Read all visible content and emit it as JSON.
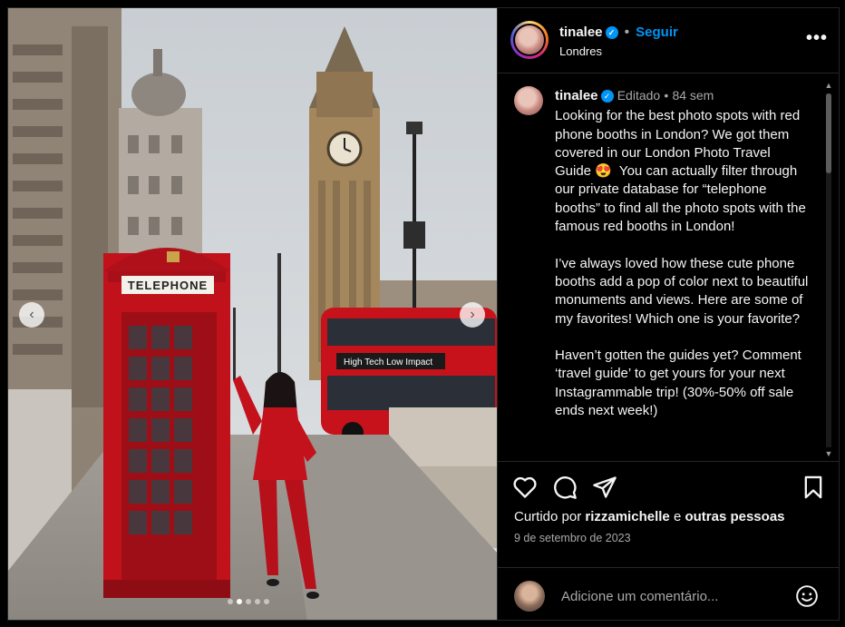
{
  "photo": {
    "booth_sign": "TELEPHONE",
    "bus_banner": "High Tech Low Impact"
  },
  "carousel": {
    "current": 2,
    "total": 5
  },
  "header": {
    "username": "tinalee",
    "separator": "•",
    "follow_label": "Seguir",
    "location": "Londres",
    "more_label": "•••"
  },
  "caption": {
    "username": "tinalee",
    "edited_label": "Editado",
    "separator": "•",
    "age": "84 sem",
    "text": "Looking for the best photo spots with red phone booths in London? We got them covered in our London Photo Travel Guide 😍  You can actually filter through our private database for “telephone booths” to find all the photo spots with the famous red booths in London!\n\nI’ve always loved how these cute phone booths add a pop of color next to beautiful monuments and views. Here are some of my favorites! Which one is your favorite?\n\nHaven’t gotten the guides yet? Comment ‘travel guide’ to get yours for your next Instagrammable trip! (30%-50% off sale ends next week!)"
  },
  "likes": {
    "prefix": "Curtido por",
    "user": "rizzamichelle",
    "conjunction": "e",
    "others": "outras pessoas"
  },
  "date": "9 de setembro de 2023",
  "comment": {
    "placeholder": "Adicione um comentário..."
  },
  "icons": {
    "verified": "verified-badge-icon",
    "like": "heart-icon",
    "comment": "comment-icon",
    "share": "paper-plane-icon",
    "save": "bookmark-icon",
    "emoji": "emoji-icon",
    "prev": "chevron-left-icon",
    "next": "chevron-right-icon"
  },
  "colors": {
    "accent": "#0095f6",
    "background": "#000000",
    "muted": "#a8a8a8"
  }
}
